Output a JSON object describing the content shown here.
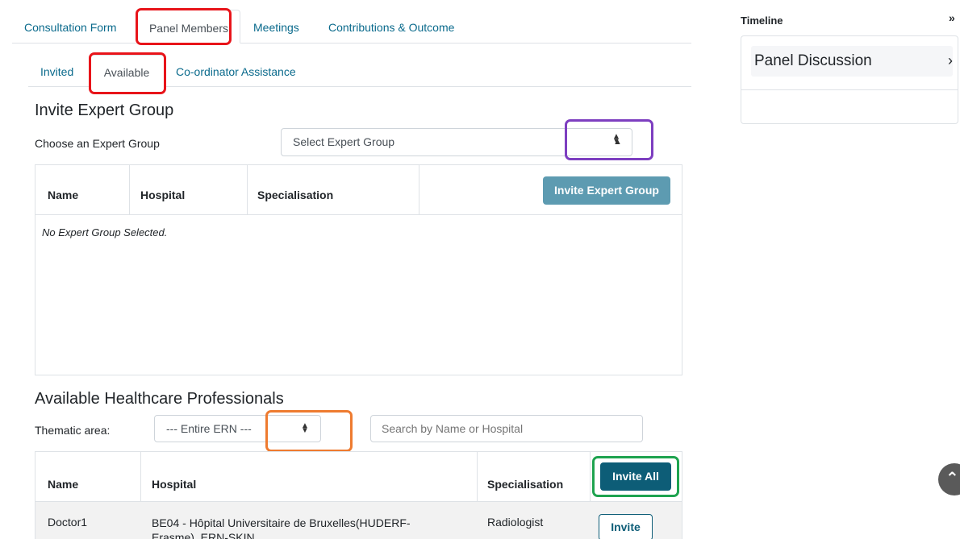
{
  "tabs": [
    {
      "label": "Consultation Form"
    },
    {
      "label": "Panel Members"
    },
    {
      "label": "Meetings"
    },
    {
      "label": "Contributions & Outcome"
    }
  ],
  "subtabs": [
    {
      "label": "Invited"
    },
    {
      "label": "Available"
    },
    {
      "label": "Co-ordinator Assistance"
    }
  ],
  "expert_group": {
    "heading": "Invite Expert Group",
    "choose_label": "Choose an Expert Group",
    "select_value": "Select Expert Group",
    "columns": [
      "Name",
      "Hospital",
      "Specialisation"
    ],
    "invite_button": "Invite Expert Group",
    "empty_text": "No Expert Group Selected."
  },
  "professionals": {
    "heading": "Available Healthcare Professionals",
    "thematic_label": "Thematic area:",
    "thematic_value": "--- Entire ERN ---",
    "search_placeholder": "Search by Name or Hospital",
    "columns": [
      "Name",
      "Hospital",
      "Specialisation"
    ],
    "invite_all_button": "Invite All",
    "rows": [
      {
        "name": "Doctor1",
        "hospital_line1": "BE04 - Hôpital Universitaire de Bruxelles(HUDERF-",
        "hospital_line2": "Erasme), ERN-SKIN",
        "specialisation": "Radiologist",
        "action": "Invite"
      }
    ]
  },
  "timeline": {
    "title": "Timeline",
    "card_title": "Panel Discussion"
  },
  "icons": {
    "select_arrows": "up-down-caret-icon",
    "card_chevron": "chevron-right-icon",
    "collapse": "double-chevron-down-icon",
    "scroll_top": "scroll-to-top-icon"
  },
  "colors": {
    "link": "#0a6a8c",
    "primary_dark": "#0d5d77",
    "primary_muted": "#5d9bb1",
    "highlight_red": "#e8141a",
    "highlight_purple": "#7d3ec0",
    "highlight_orange": "#ee7b30",
    "highlight_green": "#1ea34f"
  }
}
